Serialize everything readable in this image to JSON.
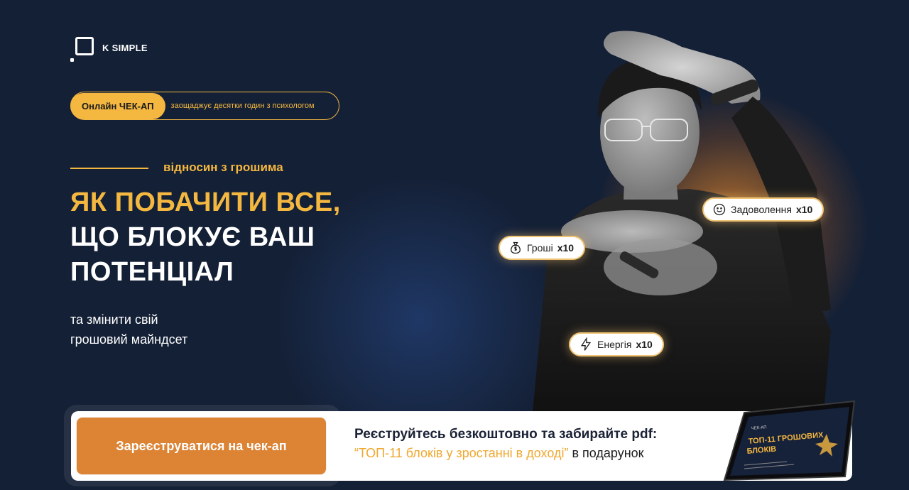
{
  "brand": {
    "name": "K SIMPLE"
  },
  "pill": {
    "badge": "Онлайн ЧЕК-АП",
    "text": "заощаджує десятки годин з психологом"
  },
  "hero": {
    "tagline": "відносин з грошима",
    "headline_line1": "ЯК ПОБАЧИТИ ВСЕ,",
    "headline_line2": "ЩО БЛОКУЄ ВАШ",
    "headline_line3": "ПОТЕНЦІАЛ",
    "subtitle_line1": "та змінити свій",
    "subtitle_line2": "грошовий майндсет"
  },
  "chips": {
    "money": {
      "label": "Гроші",
      "mult": "x10",
      "icon": "money-bag-icon"
    },
    "satisfaction": {
      "label": "Задоволення",
      "mult": "x10",
      "icon": "smile-icon"
    },
    "energy": {
      "label": "Енергія",
      "mult": "x10",
      "icon": "lightning-icon"
    }
  },
  "cta": {
    "button_label": "Зареєструватися на чек-ап",
    "title": "Реєструйтесь безкоштовно та забирайте pdf:",
    "quote": "“ТОП-11 блоків у зростанні в доході”",
    "suffix": " в подарунок"
  },
  "tablet": {
    "header": "ЧЕК-АП",
    "title_line1": "ТОП-11 ГРОШОВИХ",
    "title_line2": "БЛОКІВ"
  },
  "colors": {
    "background": "#142036",
    "accent": "#f4b740",
    "button": "#dc8334"
  }
}
